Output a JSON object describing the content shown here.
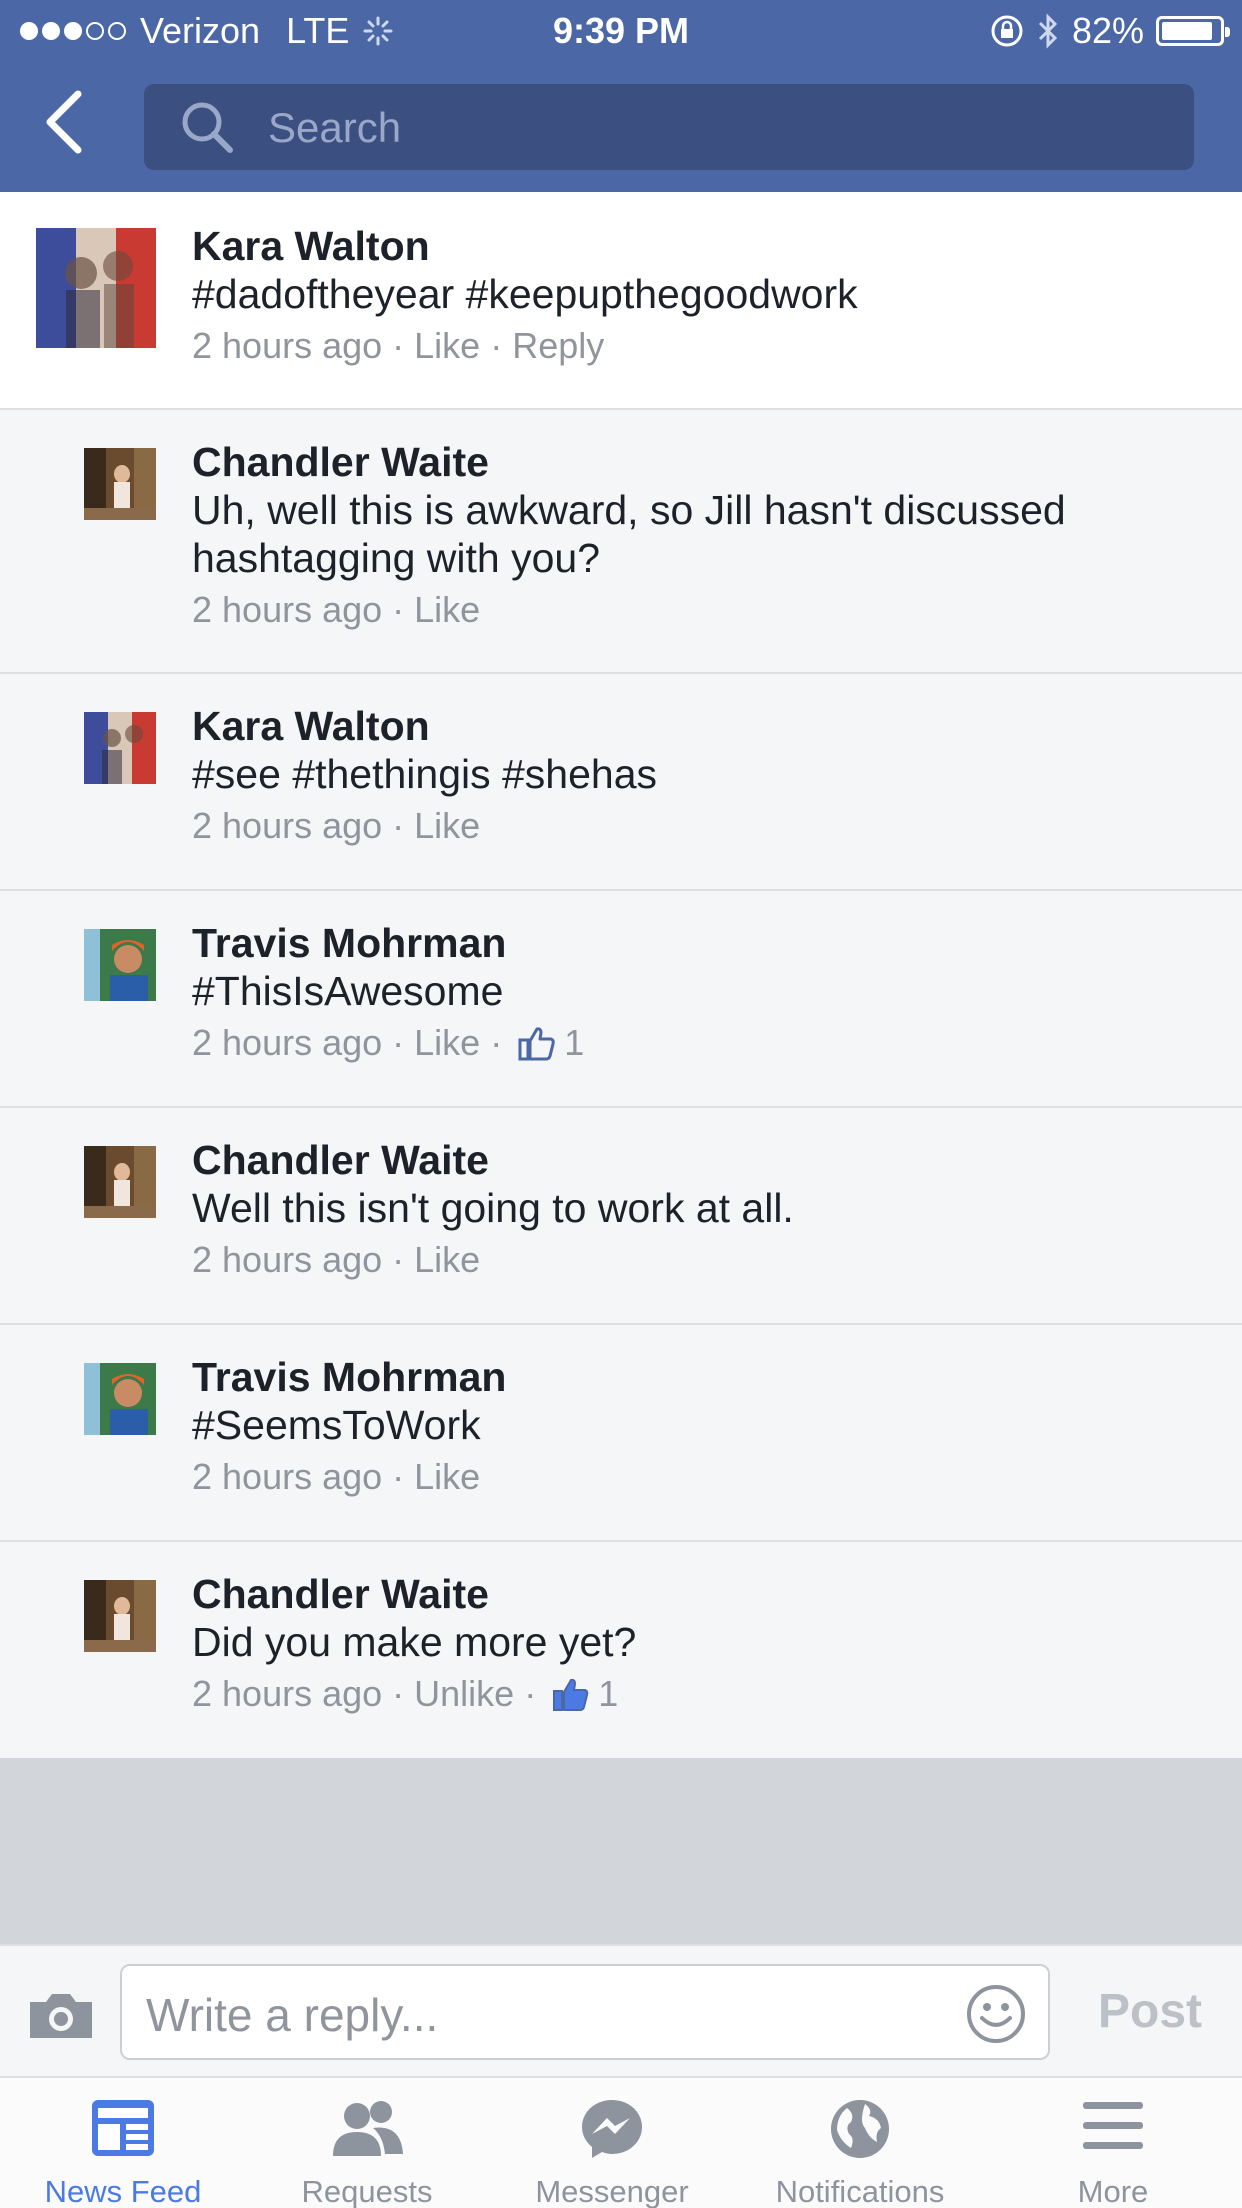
{
  "status_bar": {
    "carrier": "Verizon",
    "network": "LTE",
    "time": "9:39 PM",
    "battery": "82%",
    "battery_level": 0.82
  },
  "search": {
    "placeholder": "Search"
  },
  "comments": [
    {
      "author": "Kara Walton",
      "text": "#dadoftheyear #keepupthegoodwork",
      "time": "2 hours ago",
      "like": "Like",
      "reply": "Reply"
    },
    {
      "author": "Chandler Waite",
      "text": "Uh, well this is awkward, so Jill hasn't discussed hashtagging with you?",
      "time": "2 hours ago",
      "like": "Like"
    },
    {
      "author": "Kara Walton",
      "text": "#see #thethingis #shehas",
      "time": "2 hours ago",
      "like": "Like"
    },
    {
      "author": "Travis Mohrman",
      "text": "#ThisIsAwesome",
      "time": "2 hours ago",
      "like": "Like",
      "likes": "1"
    },
    {
      "author": "Chandler Waite",
      "text": "Well this isn't going to work at all.",
      "time": "2 hours ago",
      "like": "Like"
    },
    {
      "author": "Travis Mohrman",
      "text": "#SeemsToWork",
      "time": "2 hours ago",
      "like": "Like"
    },
    {
      "author": "Chandler Waite",
      "text": "Did you make more yet?",
      "time": "2 hours ago",
      "like": "Unlike",
      "likes": "1"
    }
  ],
  "composer": {
    "placeholder": "Write a reply...",
    "post": "Post"
  },
  "tabs": [
    {
      "label": "News Feed",
      "icon": "news-feed-icon"
    },
    {
      "label": "Requests",
      "icon": "requests-icon"
    },
    {
      "label": "Messenger",
      "icon": "messenger-icon"
    },
    {
      "label": "Notifications",
      "icon": "globe-icon"
    },
    {
      "label": "More",
      "icon": "menu-icon"
    }
  ],
  "colors": {
    "header": "#4b67a6",
    "search_box": "#3b4f80",
    "active_tab": "#4b7ae5",
    "meta_text": "#90949c"
  }
}
